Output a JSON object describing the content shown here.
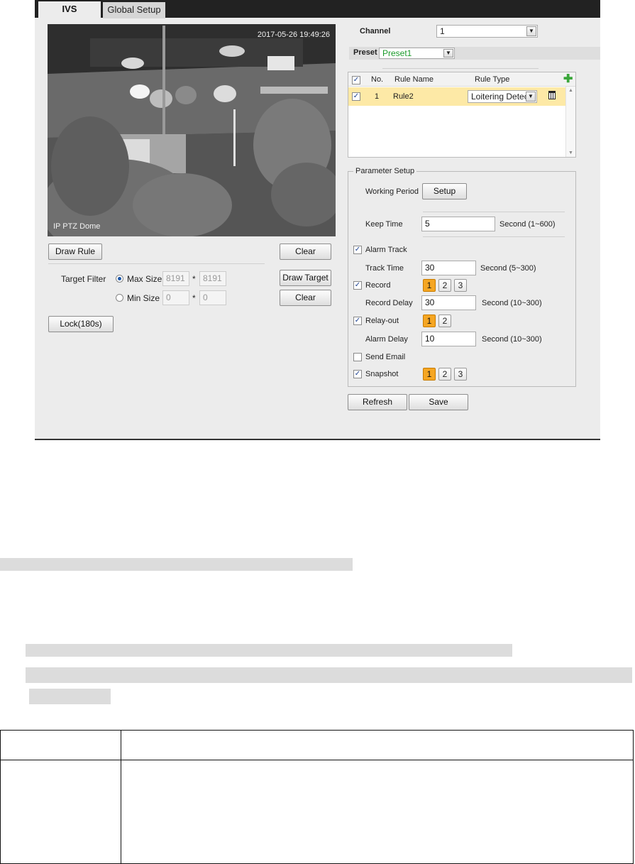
{
  "tabs": [
    {
      "label": "IVS"
    },
    {
      "label": "Global Setup"
    }
  ],
  "video": {
    "timestamp": "2017-05-26 19:49:26",
    "camera_name": "IP PTZ Dome"
  },
  "left": {
    "draw_rule": "Draw Rule",
    "clear": "Clear",
    "target_filter": "Target Filter",
    "max_size": "Max Size",
    "max_w": "8191",
    "max_h": "8191",
    "min_size": "Min Size",
    "min_w": "0",
    "min_h": "0",
    "sep": "*",
    "draw_target": "Draw Target",
    "clear2": "Clear",
    "lock": "Lock(180s)"
  },
  "right": {
    "channel_label": "Channel",
    "channel_value": "1",
    "preset_label": "Preset",
    "preset_value": "Preset1",
    "rules_header": {
      "no": "No.",
      "name": "Rule Name",
      "type": "Rule Type"
    },
    "rules": [
      {
        "no": "1",
        "name": "Rule2",
        "type": "Loitering Detec"
      }
    ],
    "param_legend": "Parameter Setup",
    "working_period": "Working Period",
    "setup": "Setup",
    "keep_time": "Keep Time",
    "keep_time_val": "5",
    "keep_time_unit": "Second (1~600)",
    "alarm_track": "Alarm Track",
    "track_time": "Track Time",
    "track_time_val": "30",
    "track_time_unit": "Second (5~300)",
    "record": "Record",
    "record_channels": [
      "1",
      "2",
      "3"
    ],
    "record_delay": "Record Delay",
    "record_delay_val": "30",
    "record_delay_unit": "Second (10~300)",
    "relay_out": "Relay-out",
    "relay_channels": [
      "1",
      "2"
    ],
    "alarm_delay": "Alarm Delay",
    "alarm_delay_val": "10",
    "alarm_delay_unit": "Second (10~300)",
    "send_email": "Send Email",
    "snapshot": "Snapshot",
    "snapshot_channels": [
      "1",
      "2",
      "3"
    ],
    "refresh": "Refresh",
    "save": "Save"
  },
  "colors": {
    "accent": "#f5a623",
    "selected_row": "#fde9a6",
    "preset_green": "#1a9a2a",
    "add_icon": "#3aa63a"
  }
}
